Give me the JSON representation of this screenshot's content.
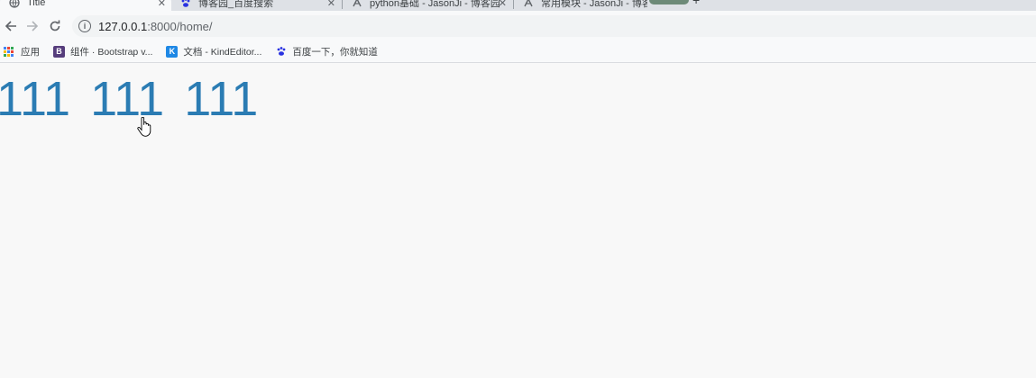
{
  "tabs": [
    {
      "title": "Title",
      "active": true
    },
    {
      "title": "博客园_百度搜索",
      "active": false
    },
    {
      "title": "python基础 - JasonJi - 博客园",
      "active": false
    },
    {
      "title": "常用模块 - JasonJi - 博客园",
      "active": false
    }
  ],
  "address": {
    "host": "127.0.0.1",
    "path": ":8000/home/"
  },
  "bookmarks": [
    {
      "label": "应用"
    },
    {
      "label": "组件 · Bootstrap v...",
      "badge": "B"
    },
    {
      "label": "文档 - KindEditor...",
      "badge": "K"
    },
    {
      "label": "百度一下，你就知道"
    }
  ],
  "page": {
    "items": [
      "111",
      "111",
      "111"
    ]
  },
  "colors": {
    "link_blue": "#2b7cb3",
    "bootstrap": "#563d7c",
    "kindeditor": "#1e88e5",
    "baidu": "#2932e1"
  },
  "icons": {
    "tab0": "globe-icon",
    "tab1": "baidu-paw-icon",
    "tab2": "cnblogs-icon",
    "tab3": "cnblogs-icon"
  }
}
